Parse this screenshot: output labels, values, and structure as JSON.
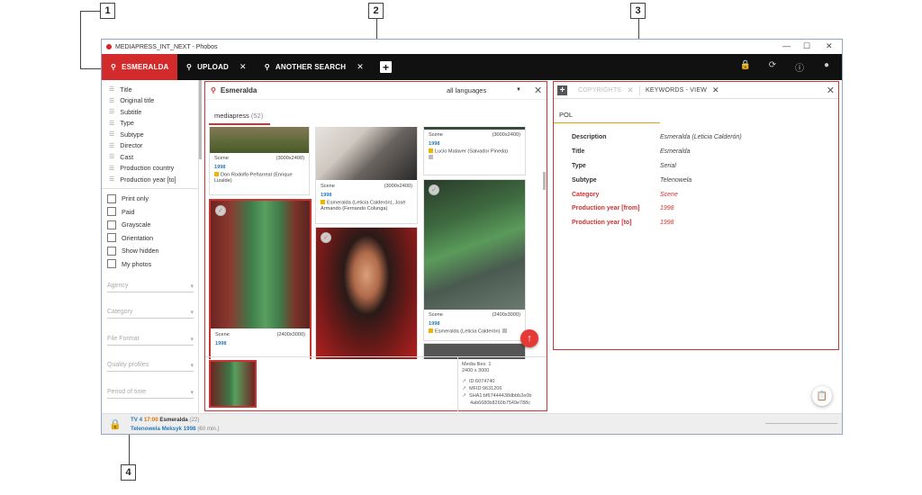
{
  "callouts": [
    "1",
    "2",
    "3",
    "4"
  ],
  "window": {
    "title": "MEDIAPRESS_INT_NEXT - Phobos",
    "controls": [
      "—",
      "☐",
      "✕"
    ]
  },
  "nav": {
    "tabs": [
      {
        "label": "ESMERALDA",
        "active": true
      },
      {
        "label": "UPLOAD"
      },
      {
        "label": "ANOTHER SEARCH"
      }
    ],
    "close_icon": "✕",
    "add_label": "+"
  },
  "sidebar": {
    "fields": [
      "Title",
      "Original title",
      "Subtitle",
      "Type",
      "Subtype",
      "Director",
      "Cast",
      "Production country",
      "Production year [to]"
    ],
    "checks": [
      "Print only",
      "Paid",
      "Grayscale",
      "Orientation",
      "Show hidden",
      "My photos"
    ],
    "dropdowns": [
      "Agency",
      "Category",
      "File Format",
      "Quality profiles",
      "Period of time"
    ]
  },
  "search": {
    "query": "Esmeralda",
    "language": "all languages",
    "source": "mediapress",
    "count": "(52)"
  },
  "cards": [
    {
      "type": "Scene",
      "size": "(3000x2400)",
      "year": "1998",
      "caption": "Don Rodolfo Peñarreal (Enrique Lizalde)"
    },
    {
      "type": "Scene",
      "size": "(3000x2400)",
      "year": "1998",
      "caption": "Esmeralda (Leticia Calderón), José Armando (Fernando Colunga)"
    },
    {
      "type": "Scene",
      "size": "(3000x2400)",
      "year": "1998",
      "caption": "Lucio Malaver (Salvador Pineda)"
    },
    {
      "type": "Scene",
      "size": "(2400x3000)",
      "year": "1998",
      "caption": ""
    },
    {
      "type": "Scene",
      "size": "(2400x3000)",
      "year": "1998",
      "caption": "Esmeralda (Leticia Calderón)"
    }
  ],
  "bottom": {
    "media_files": "Media files: 1",
    "dims": "2400 x 3000",
    "id": "ID:6074740",
    "mfid": "MFID:9631206",
    "sha1": "SHA1:bf67444438dbbb2e0b",
    "sha1b": "4ab6680b8260b7549e788c"
  },
  "right": {
    "tabs": [
      "COPYRIGHTS",
      "KEYWORDS - VIEW"
    ],
    "lang": "POL",
    "props": [
      {
        "k": "Description",
        "v": "Esmeralda (Leticia Calderón)",
        "red": false
      },
      {
        "k": "Title",
        "v": "Esmeralda",
        "red": false
      },
      {
        "k": "Type",
        "v": "Serial",
        "red": false
      },
      {
        "k": "Subtype",
        "v": "Telenowela",
        "red": false
      },
      {
        "k": "Category",
        "v": "Scene",
        "red": true
      },
      {
        "k": "Production year [from]",
        "v": "1998",
        "red": true
      },
      {
        "k": "Production year [to]",
        "v": "1998",
        "red": true
      }
    ]
  },
  "status": {
    "channel": "TV 4",
    "time": "17:00",
    "title": "Esmeralda",
    "count": "(22)",
    "line2": "Telenowela Meksyk 1998",
    "duration": "(60 min.)"
  }
}
